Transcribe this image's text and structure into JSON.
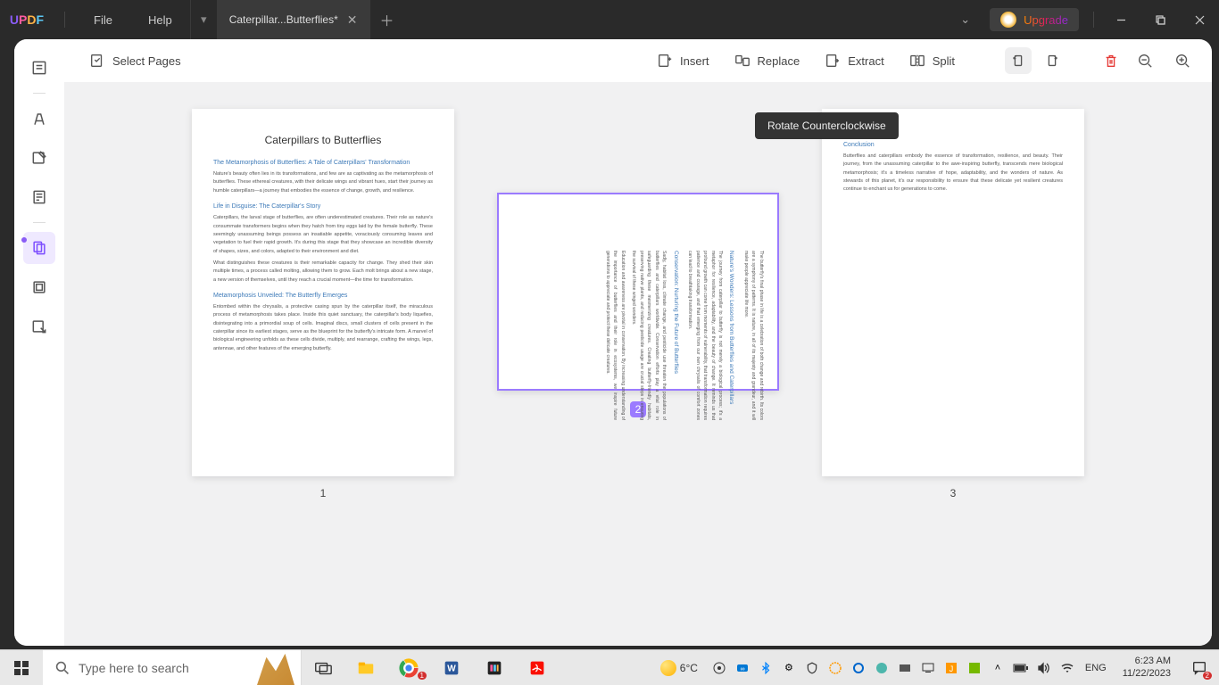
{
  "app": {
    "name": "UPDF"
  },
  "menu": {
    "file": "File",
    "help": "Help"
  },
  "tab": {
    "title": "Caterpillar...Butterflies*"
  },
  "upgrade": {
    "label": "Upgrade"
  },
  "toolbar": {
    "select": "Select Pages",
    "insert": "Insert",
    "replace": "Replace",
    "extract": "Extract",
    "split": "Split"
  },
  "tooltip": {
    "rotate_ccw": "Rotate Counterclockwise"
  },
  "pages": {
    "p1": {
      "num": "1",
      "title": "Caterpillars to Butterflies",
      "h1": "The Metamorphosis of Butterflies: A Tale of Caterpillars' Transformation",
      "p1": "Nature's beauty often lies in its transformations, and few are as captivating as the metamorphosis of butterflies. These ethereal creatures, with their delicate wings and vibrant hues, start their journey as humble caterpillars—a journey that embodies the essence of change, growth, and resilience.",
      "h2": "Life in Disguise: The Caterpillar's Story",
      "p2": "Caterpillars, the larval stage of butterflies, are often underestimated creatures. Their role as nature's consummate transformers begins when they hatch from tiny eggs laid by the female butterfly. These seemingly unassuming beings possess an insatiable appetite, voraciously consuming leaves and vegetation to fuel their rapid growth. It's during this stage that they showcase an incredible diversity of shapes, sizes, and colors, adapted to their environment and diet.",
      "p3": "What distinguishes these creatures is their remarkable capacity for change. They shed their skin multiple times, a process called molting, allowing them to grow. Each molt brings about a new stage, a new version of themselves, until they reach a crucial moment—the time for transformation.",
      "h3": "Metamorphosis Unveiled: The Butterfly Emerges",
      "p4": "Entombed within the chrysalis, a protective casing spun by the caterpillar itself, the miraculous process of metamorphosis takes place. Inside this quiet sanctuary, the caterpillar's body liquefies, disintegrating into a primordial soup of cells. Imaginal discs, small clusters of cells present in the caterpillar since its earliest stages, serve as the blueprint for the butterfly's intricate form. A marvel of biological engineering unfolds as these cells divide, multiply, and rearrange, crafting the wings, legs, antennae, and other features of the emerging butterfly."
    },
    "p2": {
      "num": "2",
      "h1": "Nature's Wonders: Lessons from Butterflies and Caterpillars",
      "p1": "The butterfly's final phase in life is a celebration of both change and rebirth. Its colors are a symphony of patterns. It is nature, in all of its majesty and grandeur, and it will make people appreciate life more.",
      "p2": "The journey from caterpillar to butterfly is not merely a biological process; it's a metaphor for resilience, adaptability, and the beauty of change. It reminds us that profound growth can come from moments of vulnerability, that transformation requires patience and courage, and that emerging from our own chrysalis of comfort zones can lead to breathtaking transformation.",
      "h2": "Conservation: Nurturing the Future of Butterflies",
      "p3": "Sadly, habitat loss, climate change, and pesticide use threaten the populations of butterflies and caterpillars worldwide. Conservation efforts play a vital role in safeguarding these mesmerizing creatures. Creating butterfly-friendly habitats, preserving native plants, and reducing pesticide usage are crucial steps in ensuring the survival of these winged wonders.",
      "p4": "Education and awareness are pivotal in conservation. By increasing understanding of the importance of butterflies and their role in ecosystems, we inspire future generations to appreciate and protect these delicate creatures."
    },
    "p3": {
      "num": "3",
      "h1": "Conclusion",
      "p1": "Butterflies and caterpillars embody the essence of transformation, resilience, and beauty. Their journey, from the unassuming caterpillar to the awe-inspiring butterfly, transcends mere biological metamorphosis; it's a timeless narrative of hope, adaptability, and the wonders of nature. As stewards of this planet, it's our responsibility to ensure that these delicate yet resilient creatures continue to enchant us for generations to come."
    }
  },
  "taskbar": {
    "search_placeholder": "Type here to search",
    "weather_temp": "6°C",
    "lang": "ENG",
    "time": "6:23 AM",
    "date": "11/22/2023",
    "notif_count": "2",
    "chrome_badge": "1"
  }
}
